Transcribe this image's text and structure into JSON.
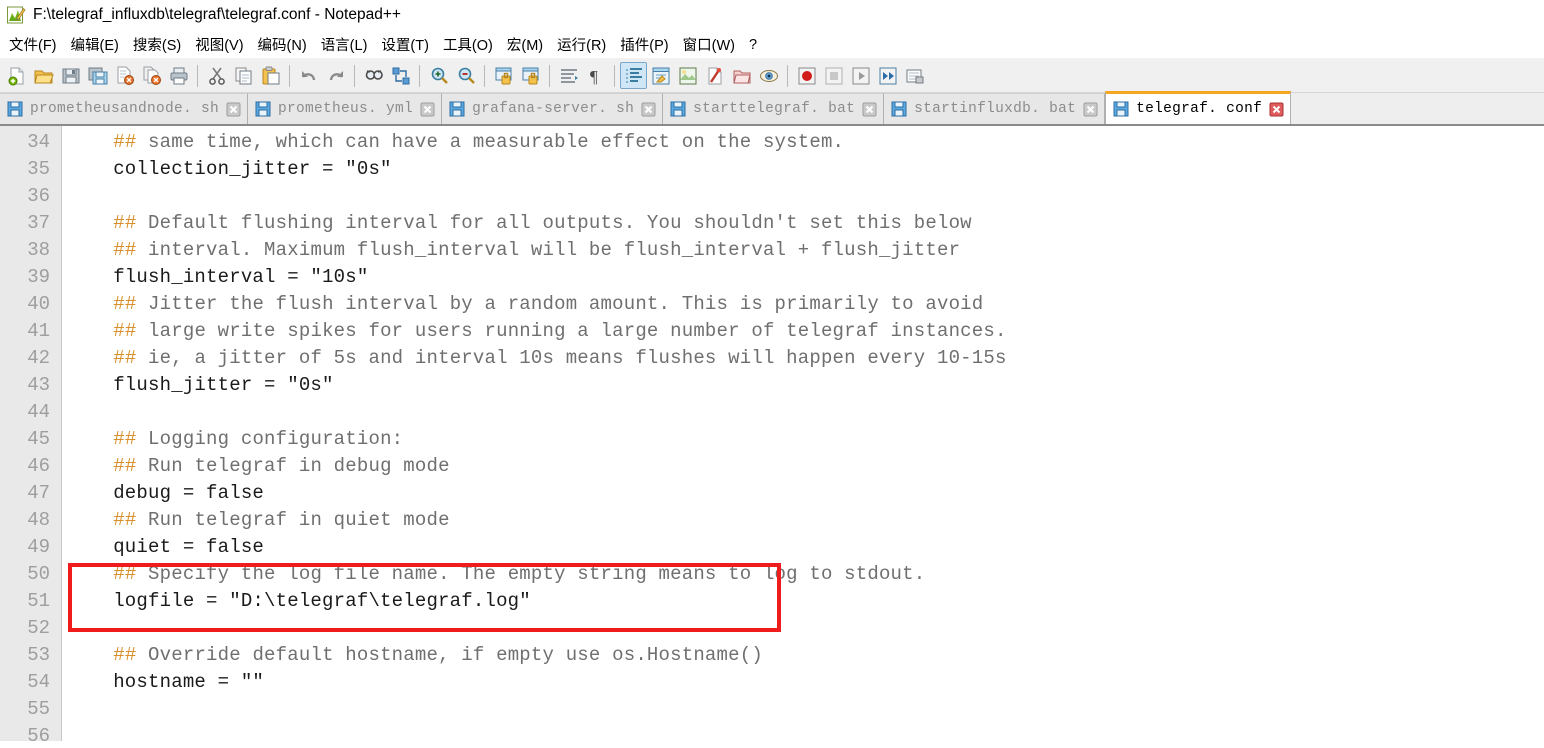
{
  "window": {
    "title": "F:\\telegraf_influxdb\\telegraf\\telegraf.conf - Notepad++",
    "icon": "notepadpp-icon"
  },
  "menubar": {
    "items": [
      {
        "label": "文件(F)",
        "name": "menu-file"
      },
      {
        "label": "编辑(E)",
        "name": "menu-edit"
      },
      {
        "label": "搜索(S)",
        "name": "menu-search"
      },
      {
        "label": "视图(V)",
        "name": "menu-view"
      },
      {
        "label": "编码(N)",
        "name": "menu-encoding"
      },
      {
        "label": "语言(L)",
        "name": "menu-language"
      },
      {
        "label": "设置(T)",
        "name": "menu-settings"
      },
      {
        "label": "工具(O)",
        "name": "menu-tools"
      },
      {
        "label": "宏(M)",
        "name": "menu-macro"
      },
      {
        "label": "运行(R)",
        "name": "menu-run"
      },
      {
        "label": "插件(P)",
        "name": "menu-plugins"
      },
      {
        "label": "窗口(W)",
        "name": "menu-window"
      },
      {
        "label": "?",
        "name": "menu-help"
      }
    ]
  },
  "toolbar": {
    "icons": [
      "new-file-icon",
      "open-file-icon",
      "save-icon",
      "save-all-icon",
      "close-file-icon",
      "close-all-icon",
      "print-icon",
      "sep",
      "cut-icon",
      "copy-icon",
      "paste-icon",
      "sep",
      "undo-icon",
      "redo-icon",
      "sep",
      "find-icon",
      "replace-icon",
      "sep",
      "zoom-in-icon",
      "zoom-out-icon",
      "sep",
      "sync-vertical-scroll-icon",
      "sync-horizontal-scroll-icon",
      "sep",
      "word-wrap-icon",
      "show-all-characters-icon",
      "sep",
      "indent-guide-icon",
      "user-defined-language-icon",
      "document-map-icon",
      "function-list-icon",
      "folder-as-workspace-icon",
      "monitoring-icon",
      "sep",
      "record-macro-icon",
      "stop-recording-icon",
      "play-macro-icon",
      "run-macro-multiple-icon",
      "save-macro-icon"
    ],
    "active_icon": "indent-guide-icon"
  },
  "tabs": [
    {
      "label": "prometheusandnode. sh",
      "name": "tab-prometheusandnode-sh",
      "active": false,
      "icon": "save-blue-icon",
      "close_icon": "close-grey-icon"
    },
    {
      "label": "prometheus. yml",
      "name": "tab-prometheus-yml",
      "active": false,
      "icon": "save-blue-icon",
      "close_icon": "close-grey-icon"
    },
    {
      "label": "grafana-server. sh",
      "name": "tab-grafana-server-sh",
      "active": false,
      "icon": "save-blue-icon",
      "close_icon": "close-grey-icon"
    },
    {
      "label": "starttelegraf. bat",
      "name": "tab-starttelegraf-bat",
      "active": false,
      "icon": "save-blue-icon",
      "close_icon": "close-grey-icon"
    },
    {
      "label": "startinfluxdb. bat",
      "name": "tab-startinfluxdb-bat",
      "active": false,
      "icon": "save-blue-icon",
      "close_icon": "close-grey-icon"
    },
    {
      "label": "telegraf. conf",
      "name": "tab-telegraf-conf",
      "active": true,
      "icon": "save-blue-icon",
      "close_icon": "close-red-icon"
    }
  ],
  "editor": {
    "first_line_number": 34,
    "lines": [
      {
        "n": "34",
        "text": "  ## same time, which can have a measurable effect on the system.",
        "comment": true
      },
      {
        "n": "35",
        "text": "  collection_jitter = \"0s\"",
        "comment": false
      },
      {
        "n": "36",
        "text": "",
        "comment": false
      },
      {
        "n": "37",
        "text": "  ## Default flushing interval for all outputs. You shouldn't set this below",
        "comment": true
      },
      {
        "n": "38",
        "text": "  ## interval. Maximum flush_interval will be flush_interval + flush_jitter",
        "comment": true
      },
      {
        "n": "39",
        "text": "  flush_interval = \"10s\"",
        "comment": false
      },
      {
        "n": "40",
        "text": "  ## Jitter the flush interval by a random amount. This is primarily to avoid",
        "comment": true
      },
      {
        "n": "41",
        "text": "  ## large write spikes for users running a large number of telegraf instances.",
        "comment": true
      },
      {
        "n": "42",
        "text": "  ## ie, a jitter of 5s and interval 10s means flushes will happen every 10-15s",
        "comment": true
      },
      {
        "n": "43",
        "text": "  flush_jitter = \"0s\"",
        "comment": false
      },
      {
        "n": "44",
        "text": "",
        "comment": false
      },
      {
        "n": "45",
        "text": "  ## Logging configuration:",
        "comment": true
      },
      {
        "n": "46",
        "text": "  ## Run telegraf in debug mode",
        "comment": true
      },
      {
        "n": "47",
        "text": "  debug = false",
        "comment": false
      },
      {
        "n": "48",
        "text": "  ## Run telegraf in quiet mode",
        "comment": true
      },
      {
        "n": "49",
        "text": "  quiet = false",
        "comment": false
      },
      {
        "n": "50",
        "text": "  ## Specify the log file name. The empty string means to log to stdout.",
        "comment": true
      },
      {
        "n": "51",
        "text": "  logfile = \"D:\\telegraf\\telegraf.log\"",
        "comment": false
      },
      {
        "n": "52",
        "text": "",
        "comment": false
      },
      {
        "n": "53",
        "text": "  ## Override default hostname, if empty use os.Hostname()",
        "comment": true
      },
      {
        "n": "54",
        "text": "  hostname = \"\"",
        "comment": false
      },
      {
        "n": "55",
        "text": "",
        "comment": false
      },
      {
        "n": "56",
        "text": "",
        "comment": false
      }
    ],
    "annotation": {
      "name": "red-highlight-box",
      "color": "#ee1c1c",
      "covers_lines": [
        "50",
        "51",
        "52"
      ]
    }
  },
  "colors": {
    "accent_tab": "#f5a623",
    "annotation_red": "#ee1c1c",
    "comment_grey": "#6f6f6f",
    "hash_orange": "#d98f2b",
    "gutter_bg": "#e9e9e9",
    "linenumber_grey": "#9e9e9e"
  }
}
